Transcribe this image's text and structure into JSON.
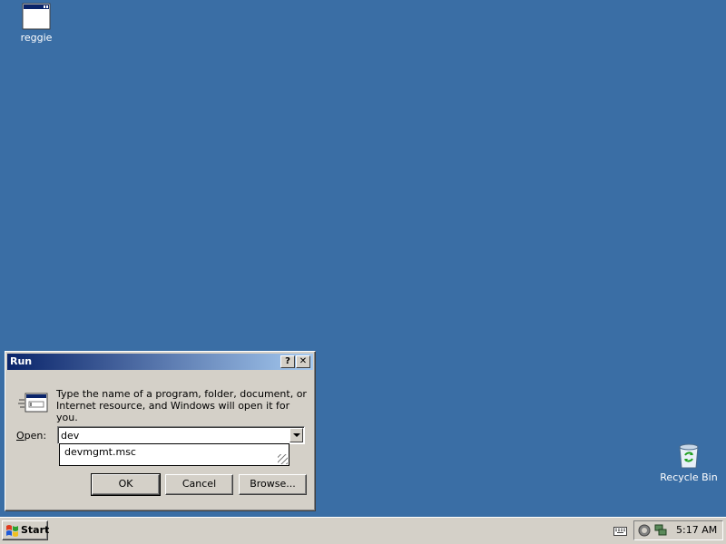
{
  "desktop": {
    "background_color": "#3a6ea5",
    "icons": [
      {
        "label": "reggie",
        "icon": "window-icon"
      },
      {
        "label": "Recycle Bin",
        "icon": "recycle-bin-icon"
      }
    ]
  },
  "run_dialog": {
    "title": "Run",
    "help_button": "?",
    "close_button": "✕",
    "prompt": "Type the name of a program, folder, document, or Internet resource, and Windows will open it for you.",
    "open_label_accel": "O",
    "open_label_rest": "pen:",
    "open_value": "dev",
    "autocomplete_item": "devmgmt.msc",
    "ok_label": "OK",
    "cancel_label": "Cancel",
    "browse_label": "Browse..."
  },
  "taskbar": {
    "start_label": "Start",
    "clock": "5:17 AM"
  },
  "colors": {
    "title_gradient_start": "#0a246a",
    "title_gradient_end": "#a6caf0",
    "face": "#d4d0c8"
  }
}
